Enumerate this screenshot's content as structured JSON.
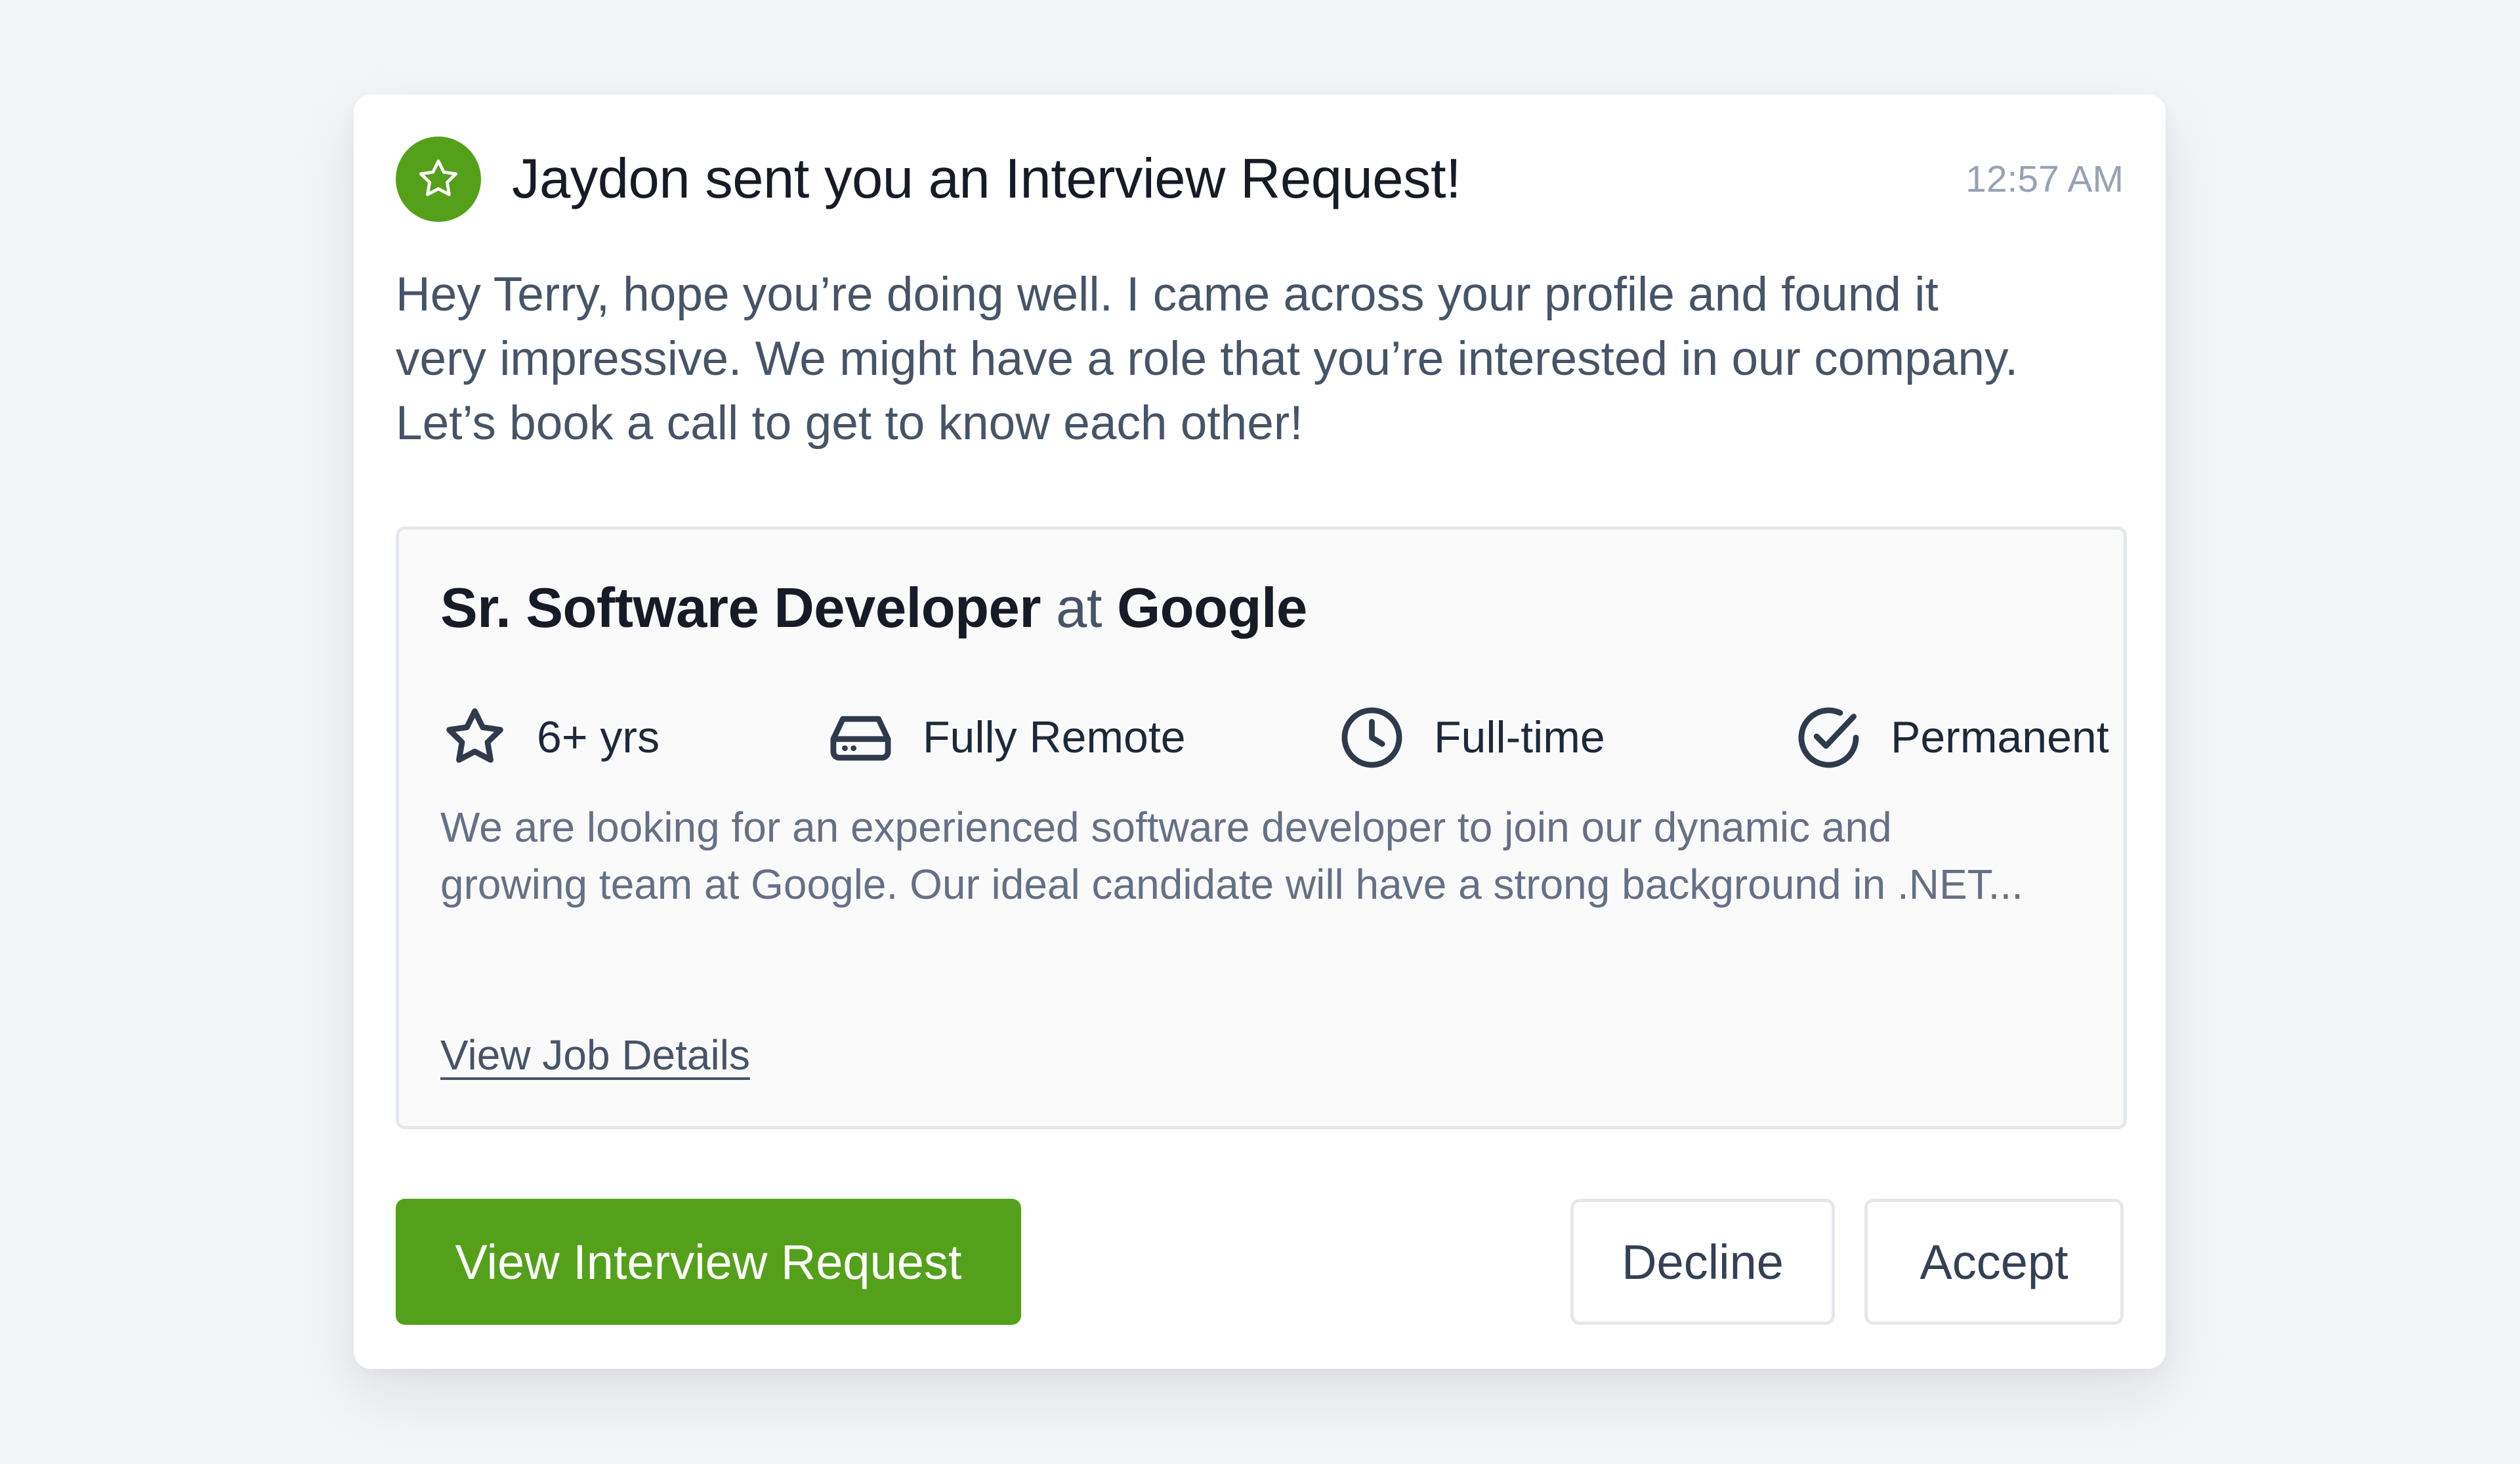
{
  "notification": {
    "title": "Jaydon sent you an Interview Request!",
    "timestamp": "12:57 AM",
    "header_icon": "star-icon",
    "message_lines": [
      "Hey Terry, hope you’re doing well. I came across your profile and found it",
      "very impressive. We might have a role that you’re interested in our company.",
      "Let’s book a call to get to know each other!"
    ]
  },
  "job": {
    "role": "Sr. Software Developer",
    "at_word": "at",
    "company": "Google",
    "meta": [
      {
        "icon": "star-icon",
        "label": "6+ yrs"
      },
      {
        "icon": "hard-drive-icon",
        "label": "Fully Remote"
      },
      {
        "icon": "clock-icon",
        "label": "Full-time"
      },
      {
        "icon": "check-circle-icon",
        "label": "Permanent"
      }
    ],
    "description_lines": [
      "We are looking for an experienced software developer to join our dynamic and",
      "growing team at Google. Our ideal candidate will have a strong background in .NET..."
    ],
    "details_link": "View Job Details"
  },
  "actions": {
    "view_request": "View Interview Request",
    "decline": "Decline",
    "accept": "Accept"
  },
  "colors": {
    "accent": "#55a01b",
    "background": "#f4f5f7",
    "title_text": "#161b26",
    "body_text": "#475467",
    "muted_text": "#98a2b3",
    "border": "#e4e7ec"
  }
}
